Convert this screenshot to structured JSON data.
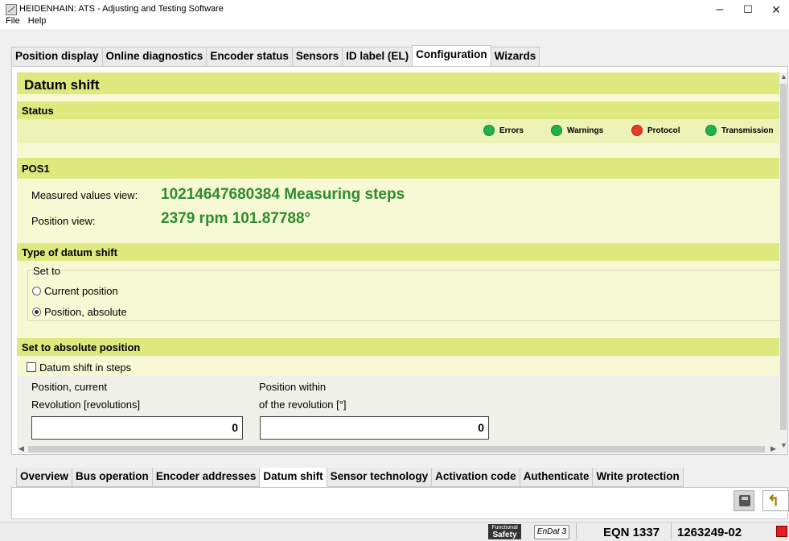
{
  "window": {
    "title": "HEIDENHAIN: ATS - Adjusting and Testing Software",
    "menu": [
      "File",
      "Help"
    ],
    "controls": {
      "minimize": "–",
      "maximize": "☐",
      "close": "✕"
    }
  },
  "top_tabs": [
    {
      "label": "Position display",
      "active": false
    },
    {
      "label": "Online diagnostics",
      "active": false
    },
    {
      "label": "Encoder status",
      "active": false
    },
    {
      "label": "Sensors",
      "active": false
    },
    {
      "label": "ID label (EL)",
      "active": false
    },
    {
      "label": "Configuration",
      "active": true
    },
    {
      "label": "Wizards",
      "active": false
    }
  ],
  "page": {
    "title": "Datum shift",
    "status": {
      "header": "Status",
      "indicators": [
        {
          "label": "Errors",
          "color": "#22b14c"
        },
        {
          "label": "Warnings",
          "color": "#22b14c"
        },
        {
          "label": "Protocol",
          "color": "#e8392a"
        },
        {
          "label": "Transmission",
          "color": "#22b14c"
        }
      ]
    },
    "pos1": {
      "header": "POS1",
      "measured_label": "Measured values view:",
      "measured_value": "10214647680384 Measuring steps",
      "position_label": "Position view:",
      "position_value": "2379 rpm 101.87788°"
    },
    "type": {
      "header": "Type of datum shift",
      "group_label": "Set to",
      "options": [
        {
          "label": "Current position",
          "selected": false
        },
        {
          "label": "Position, absolute",
          "selected": true
        }
      ]
    },
    "absolute": {
      "header": "Set to absolute position",
      "checkbox_label": "Datum shift in steps",
      "checkbox_checked": false,
      "rev_label_1": "Position, current",
      "rev_label_2": "Revolution [revolutions]",
      "rev_value": "0",
      "within_label_1": "Position within",
      "within_label_2": "of the revolution [°]",
      "within_value": "0"
    }
  },
  "bottom_tabs": [
    {
      "label": "Overview",
      "active": false
    },
    {
      "label": "Bus operation",
      "active": false
    },
    {
      "label": "Encoder addresses",
      "active": false
    },
    {
      "label": "Datum shift",
      "active": true
    },
    {
      "label": "Sensor technology",
      "active": false
    },
    {
      "label": "Activation code",
      "active": false
    },
    {
      "label": "Authenticate",
      "active": false
    },
    {
      "label": "Write protection",
      "active": false
    }
  ],
  "statusbar": {
    "safety_line1": "Functional",
    "safety_line2": "Safety",
    "endat": "EnDat 3",
    "encoder": "EQN 1337",
    "id": "1263249-02"
  }
}
